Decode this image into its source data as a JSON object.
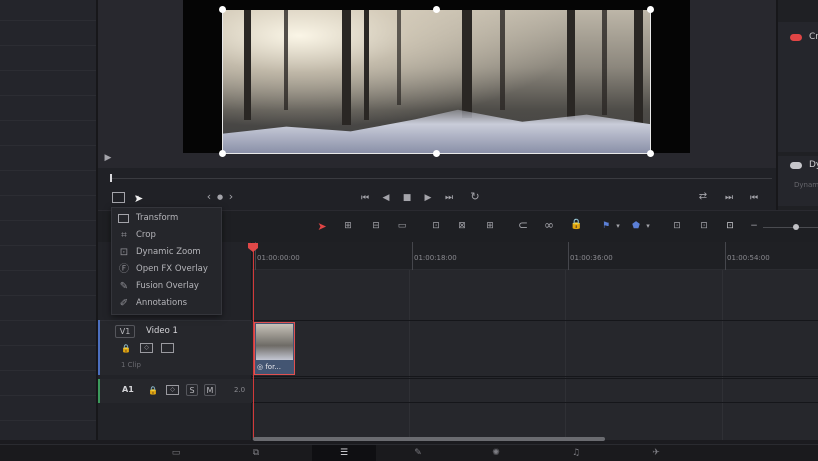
{
  "viewer": {
    "crop_mode_icon": "crop-frame-icon"
  },
  "right_panel": {
    "item1": {
      "text": "Cr",
      "toggle_color": "#e04545"
    },
    "item2": {
      "text": "Dy",
      "toggle_color": "#9a9aa0",
      "sub": "Dynam"
    }
  },
  "viewer_toolbar": {
    "nav_prev": "‹",
    "nav_next": "›"
  },
  "menu": {
    "items": [
      {
        "label": "Transform",
        "icon": "transform-icon"
      },
      {
        "label": "Crop",
        "icon": "crop-icon"
      },
      {
        "label": "Dynamic Zoom",
        "icon": "dynamic-zoom-icon"
      },
      {
        "label": "Open FX Overlay",
        "icon": "openfx-icon"
      },
      {
        "label": "Fusion Overlay",
        "icon": "fusion-overlay-icon"
      },
      {
        "label": "Annotations",
        "icon": "annotations-icon"
      }
    ]
  },
  "ruler": {
    "timecodes": [
      "01:00:00:00",
      "01:00:18:00",
      "01:00:36:00",
      "01:00:54:00"
    ]
  },
  "tracks": {
    "v1": {
      "tag": "V1",
      "name": "Video 1",
      "clips": "1 Clip"
    },
    "a1": {
      "tag": "A1",
      "solo": "S",
      "mute": "M",
      "level": "2.0"
    }
  },
  "clip": {
    "label": "for..."
  },
  "colors": {
    "accent": "#e04848",
    "clip": "#435572"
  }
}
